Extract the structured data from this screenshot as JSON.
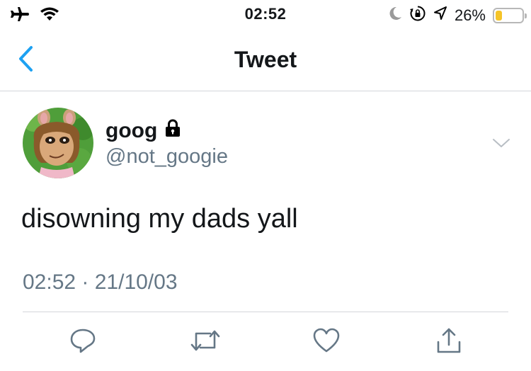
{
  "status_bar": {
    "time": "02:52",
    "battery_percent": "26%",
    "battery_level": 0.26,
    "icons": [
      "airplane-icon",
      "wifi-icon",
      "moon-icon",
      "rotation-lock-icon",
      "location-icon",
      "battery-icon"
    ]
  },
  "nav": {
    "title": "Tweet",
    "back_icon": "chevron-left-icon"
  },
  "tweet": {
    "author_name": "goog",
    "author_handle": "@not_googie",
    "locked_icon": "lock-icon",
    "text": "disowning my dads yall",
    "timestamp": "02:52 · 21/10/03"
  },
  "actions": [
    {
      "name": "reply",
      "icon": "reply-icon"
    },
    {
      "name": "retweet",
      "icon": "retweet-icon"
    },
    {
      "name": "like",
      "icon": "heart-icon"
    },
    {
      "name": "share",
      "icon": "share-icon"
    }
  ],
  "colors": {
    "accent": "#1da1f2",
    "secondary_text": "#657786",
    "primary_text": "#14171a",
    "divider": "#d3d6da",
    "battery_fill": "#f5c428"
  }
}
